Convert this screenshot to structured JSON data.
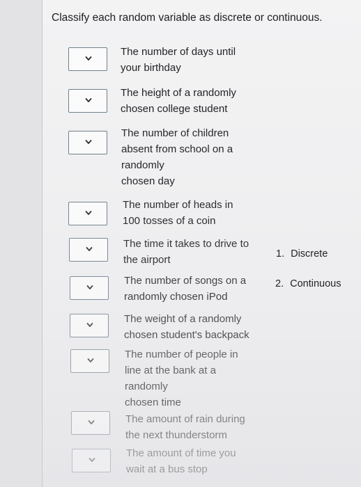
{
  "question": {
    "title": "Classify each random variable as discrete or continuous."
  },
  "items": [
    {
      "label_lines": [
        "The number of days until",
        "your birthday"
      ],
      "selected": ""
    },
    {
      "label_lines": [
        "The height of a randomly",
        "chosen college student"
      ],
      "selected": ""
    },
    {
      "label_lines": [
        "The number of children",
        "absent from school on a",
        "randomly",
        "chosen day"
      ],
      "selected": ""
    },
    {
      "label_lines": [
        "The number of heads in",
        "100 tosses of a coin"
      ],
      "selected": ""
    },
    {
      "label_lines": [
        "The time it takes to drive to",
        "the airport"
      ],
      "selected": ""
    },
    {
      "label_lines": [
        "The number of songs on a",
        "randomly chosen iPod"
      ],
      "selected": ""
    },
    {
      "label_lines": [
        "The weight of a randomly",
        "chosen student's backpack"
      ],
      "selected": ""
    },
    {
      "label_lines": [
        "The number of people in",
        "line at the bank at a",
        "randomly",
        "chosen time"
      ],
      "selected": ""
    },
    {
      "label_lines": [
        "The amount of rain during",
        "the next thunderstorm"
      ],
      "selected": ""
    },
    {
      "label_lines": [
        "The amount of time you",
        "wait at a bus stop"
      ],
      "selected": ""
    }
  ],
  "options": [
    {
      "number": "1.",
      "label": "Discrete"
    },
    {
      "number": "2.",
      "label": "Continuous"
    }
  ],
  "icons": {
    "dropdown": "chevron-down-icon"
  },
  "colors": {
    "select_border": "#6f7f8a",
    "text": "#232327"
  }
}
